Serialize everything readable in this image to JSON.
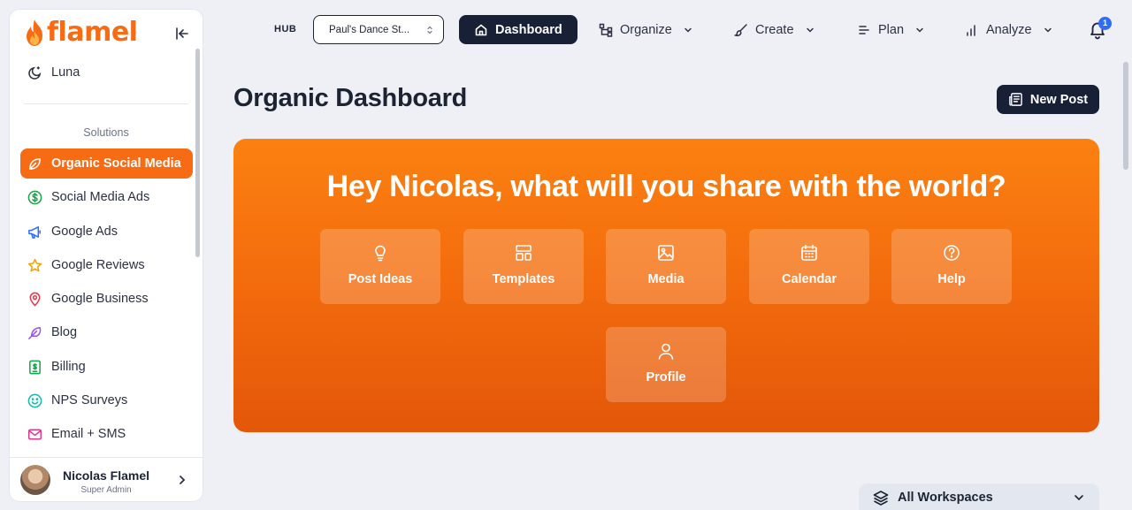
{
  "brand": {
    "name": "flamel",
    "accent": "#f76b15",
    "dark": "#182036"
  },
  "sidebar": {
    "luna_label": "Luna",
    "section_label": "Solutions",
    "items": [
      {
        "label": "Organic Social Media",
        "icon": "leaf-icon",
        "active": true
      },
      {
        "label": "Social Media Ads",
        "icon": "dollar-circle-icon"
      },
      {
        "label": "Google Ads",
        "icon": "megaphone-icon"
      },
      {
        "label": "Google Reviews",
        "icon": "star-icon"
      },
      {
        "label": "Google Business",
        "icon": "map-pin-icon"
      },
      {
        "label": "Blog",
        "icon": "feather-icon"
      },
      {
        "label": "Billing",
        "icon": "billing-icon"
      },
      {
        "label": "NPS Surveys",
        "icon": "smiley-icon"
      },
      {
        "label": "Email + SMS",
        "icon": "mail-icon"
      }
    ],
    "user": {
      "name": "Nicolas Flamel",
      "role": "Super Admin"
    }
  },
  "topnav": {
    "hub_label": "HUB",
    "hub_value": "Paul's Dance St...",
    "dashboard": "Dashboard",
    "organize": "Organize",
    "create": "Create",
    "plan": "Plan",
    "analyze": "Analyze",
    "notification_count": "1"
  },
  "main": {
    "title": "Organic Dashboard",
    "new_post": "New Post",
    "hero_title": "Hey Nicolas, what will you share with the world?",
    "tiles": [
      {
        "label": "Post Ideas",
        "icon": "lightbulb-icon"
      },
      {
        "label": "Templates",
        "icon": "templates-icon"
      },
      {
        "label": "Media",
        "icon": "image-icon"
      },
      {
        "label": "Calendar",
        "icon": "calendar-icon"
      },
      {
        "label": "Help",
        "icon": "help-icon"
      },
      {
        "label": "Profile",
        "icon": "user-icon"
      }
    ],
    "workspace_select": "All Workspaces"
  }
}
